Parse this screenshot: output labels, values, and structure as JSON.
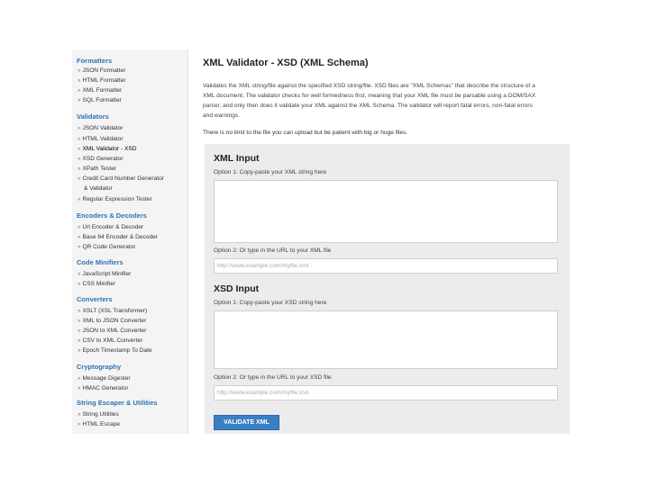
{
  "sidebar": {
    "formatters": {
      "title": "Formatters",
      "items": [
        "JSON Formatter",
        "HTML Formatter",
        "XML Formatter",
        "SQL Formatter"
      ]
    },
    "validators": {
      "title": "Validators",
      "items": [
        "JSON Validator",
        "HTML Validator",
        "XML Validator - XSD",
        "XSD Generator",
        "XPath Tester",
        "Credit Card Number Generator",
        "& Validator",
        "Regular Expression Tester"
      ]
    },
    "encoders": {
      "title": "Encoders & Decoders",
      "items": [
        "Url Encoder & Decoder",
        "Base 64 Encoder & Decoder",
        "QR Code Generator"
      ]
    },
    "minifiers": {
      "title": "Code Minifiers",
      "items": [
        "JavaScript Minifier",
        "CSS Minifier"
      ]
    },
    "converters": {
      "title": "Converters",
      "items": [
        "XSLT (XSL Transformer)",
        "XML to JSON Converter",
        "JSON to XML Converter",
        "CSV to XML Converter",
        "Epoch Timestamp To Date"
      ]
    },
    "cryptography": {
      "title": "Cryptography",
      "items": [
        "Message Digester",
        "HMAC Generator"
      ]
    },
    "string_escaper": {
      "title": "String Escaper & Utilities",
      "items": [
        "String Utilities",
        "HTML Escape"
      ]
    },
    "arrow_icon": "double-right-arrow-icon"
  },
  "main": {
    "title": "XML Validator - XSD (XML Schema)",
    "description": [
      "Validates the XML string/file against the specified XSD string/file. XSD files are \"XML Schemas\" that describe the structure of a",
      "XML document. The validator checks for well formedness first, meaning that your XML file must be parsable using a DOM/SAX",
      "parser, and only then does it validate your XML against the XML Schema. The validator will report fatal errors, non-fatal errors",
      "and warnings."
    ],
    "note": "There is no limit to the file you can upload but be patient with big or huge files."
  },
  "form": {
    "xml_section_title": "XML Input",
    "xml_option1": "Option 1: Copy-paste your XML string here",
    "xml_option2": "Option 2: Or type in the URL to your XML file",
    "xml_url_placeholder": "http://www.example.com/myfile.xml",
    "xsd_section_title": "XSD Input",
    "xsd_option1": "Option 1: Copy-paste your XSD string here",
    "xsd_option2": "Option 2: Or type in the URL to your XSD file",
    "xsd_url_placeholder": "http://www.example.com/myfile.xsd",
    "validate_button": "VALIDATE XML"
  },
  "colors": {
    "link_blue": "#3072b3",
    "button_blue": "#3a7fc2",
    "form_bg": "#ececec",
    "sidebar_bg": "#f4f4f4"
  }
}
